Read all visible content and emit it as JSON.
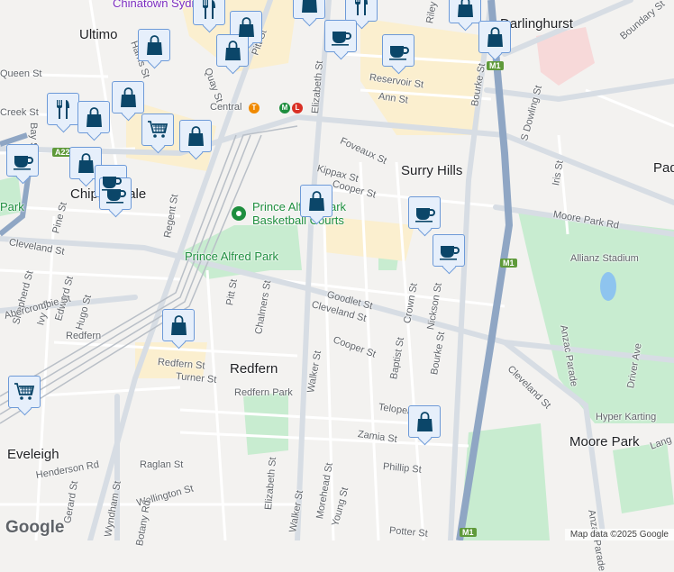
{
  "colors": {
    "marker_fill": "#e6effb",
    "marker_border": "#6d9ad8",
    "icon": "#0b4669",
    "park": "#c8ecd0",
    "road": "#d7dde4",
    "motorway": "#8fa6c4",
    "highlight": "#fbefcf"
  },
  "labels": [
    "Chinatown Sydney",
    "Ultimo",
    "Darlinghurst",
    "Surry Hills",
    "Chippendale",
    "Redfern",
    "Eveleigh",
    "Moore Park",
    "Pad",
    "Queen St",
    "Creek St",
    "Bay St",
    "Harris St",
    "Quay St",
    "Pitt St",
    "Elizabeth St",
    "Riley St",
    "Reservoir St",
    "Ann St",
    "Foveaux St",
    "Kippax St",
    "Cooper St",
    "Bourke St",
    "S Dowling St",
    "Boundary St",
    "Iris St",
    "Moore Park Rd",
    "Allianz Stadium",
    "Cleveland St",
    "Pine St",
    "Shepherd St",
    "Ivy St",
    "Edward St",
    "Hugo St",
    "Abercrombie St",
    "Regent St",
    "Pitt St",
    "Chalmers St",
    "Goodlet St",
    "Cleveland St",
    "Crown St",
    "Nickson St",
    "Baptist St",
    "Bourke St",
    "Cleveland St",
    "Anzac Parade",
    "Driver Ave",
    "Hyper Karting",
    "Redfern",
    "Redfern St",
    "Turner St",
    "Redfern Park",
    "Walker St",
    "Cooper St",
    "Telopea St",
    "Zamia St",
    "Phillip St",
    "Raglan St",
    "Henderson Rd",
    "Gerard St",
    "Wyndham St",
    "Wellington St",
    "Botany Rd",
    "Elizabeth St",
    "Walker St",
    "Morehead St",
    "Young St",
    "Potter St",
    "Prince Alfred Park",
    "Prince Alfred Park",
    "Basketball Courts",
    "Central",
    "Anzac Parade",
    "Park",
    "Lang",
    "Pine St",
    "Bray St",
    "Abercrombie St"
  ],
  "shields": [
    "A22",
    "M1",
    "M1",
    "M1"
  ],
  "rail_badges": [
    "T",
    "M",
    "L"
  ],
  "markers": [
    "restaurant",
    "bag",
    "bag",
    "cart",
    "bag",
    "coffee",
    "bag",
    "coffee",
    "coffee",
    "bag",
    "bag",
    "bag",
    "restaurant",
    "bag",
    "bag",
    "restaurant",
    "coffee",
    "coffee",
    "bag",
    "bag",
    "coffee",
    "coffee",
    "bag",
    "cart",
    "bag"
  ],
  "attribution": "Map data ©2025 Google",
  "logo": "Google"
}
